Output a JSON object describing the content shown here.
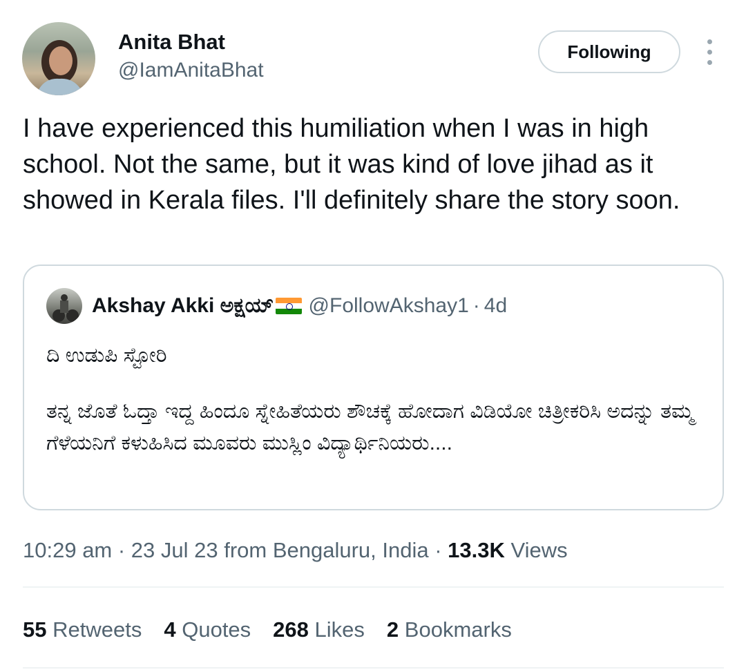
{
  "tweet": {
    "author_name": "Anita Bhat",
    "author_handle": "@IamAnitaBhat",
    "follow_label": "Following",
    "text": "I have experienced this humiliation when I was in high school. Not the same, but it was kind of love jihad as it showed in Kerala files. I'll definitely share the story soon.",
    "timestamp": "10:29 am · 23 Jul 23 from Bengaluru, India · ",
    "views_count": "13.3K",
    "views_label": " Views"
  },
  "quote": {
    "author_name": "Akshay Akki ಅಕ್ಷಯ್",
    "author_handle": "@FollowAkshay1",
    "separator": "·",
    "time": "4d",
    "title_line": "ದಿ ಉಡುಪಿ ಸ್ಟೋರಿ",
    "body": "ತನ್ನ ಜೊತೆ ಓದ್ತಾ ಇದ್ದ ಹಿಂದೂ ಸ್ನೇಹಿತೆಯರು ಶೌಚಕ್ಕೆ ಹೋದಾಗ ವಿಡಿಯೋ ಚಿತ್ರೀಕರಿಸಿ ಅದನ್ನು ತಮ್ಮ ಗೆಳೆಯನಿಗೆ ಕಳುಹಿಸಿದ ಮೂವರು ಮುಸ್ಲಿಂ ವಿದ್ಯಾರ್ಥಿನಿಯರು...."
  },
  "stats": {
    "retweets_count": "55",
    "retweets_label": "Retweets",
    "quotes_count": "4",
    "quotes_label": "Quotes",
    "likes_count": "268",
    "likes_label": "Likes",
    "bookmarks_count": "2",
    "bookmarks_label": "Bookmarks"
  },
  "icons": {
    "more": "more-vertical-icon",
    "flag": "india-flag-icon"
  }
}
